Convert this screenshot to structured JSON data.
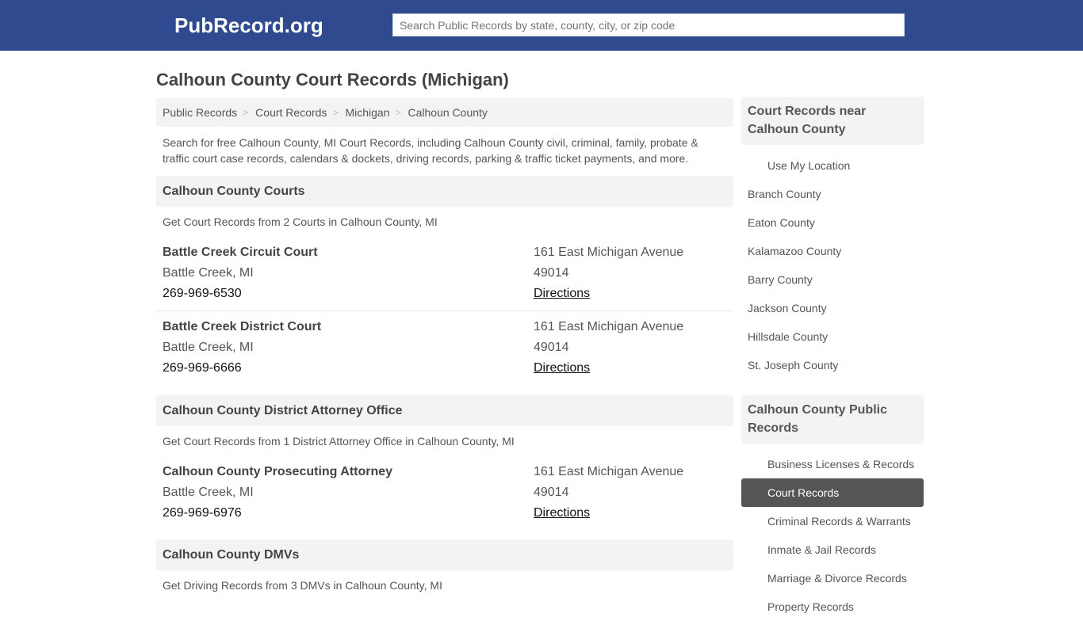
{
  "header": {
    "logo": "PubRecord.org",
    "search_placeholder": "Search Public Records by state, county, city, or zip code",
    "search_value": ""
  },
  "page_title": "Calhoun County Court Records (Michigan)",
  "breadcrumb": [
    {
      "label": "Public Records"
    },
    {
      "label": "Court Records"
    },
    {
      "label": "Michigan"
    },
    {
      "label": "Calhoun County"
    }
  ],
  "breadcrumb_separator": ">",
  "intro": "Search for free Calhoun County, MI Court Records, including Calhoun County civil, criminal, family, probate & traffic court case records, calendars & dockets, driving records, parking & traffic ticket payments, and more.",
  "sections": [
    {
      "title": "Calhoun County Courts",
      "subtitle": "Get Court Records from 2 Courts in Calhoun County, MI",
      "entries": [
        {
          "name": "Battle Creek Circuit Court",
          "city": "Battle Creek, MI",
          "phone": "269-969-6530",
          "address": "161 East Michigan Avenue",
          "zip": "49014",
          "directions": "Directions"
        },
        {
          "name": "Battle Creek District Court",
          "city": "Battle Creek, MI",
          "phone": "269-969-6666",
          "address": "161 East Michigan Avenue",
          "zip": "49014",
          "directions": "Directions"
        }
      ]
    },
    {
      "title": "Calhoun County District Attorney Office",
      "subtitle": "Get Court Records from 1 District Attorney Office in Calhoun County, MI",
      "entries": [
        {
          "name": "Calhoun County Prosecuting Attorney",
          "city": "Battle Creek, MI",
          "phone": "269-969-6976",
          "address": "161 East Michigan Avenue",
          "zip": "49014",
          "directions": "Directions"
        }
      ]
    },
    {
      "title": "Calhoun County DMVs",
      "subtitle": "Get Driving Records from 3 DMVs in Calhoun County, MI",
      "entries": []
    }
  ],
  "sidebar": {
    "nearby": {
      "title": "Court Records near Calhoun County",
      "use_location": "Use My Location",
      "items": [
        "Branch County",
        "Eaton County",
        "Kalamazoo County",
        "Barry County",
        "Jackson County",
        "Hillsdale County",
        "St. Joseph County"
      ]
    },
    "public_records": {
      "title": "Calhoun County Public Records",
      "items": [
        {
          "label": "Business Licenses & Records",
          "active": false
        },
        {
          "label": "Court Records",
          "active": true
        },
        {
          "label": "Criminal Records & Warrants",
          "active": false
        },
        {
          "label": "Inmate & Jail Records",
          "active": false
        },
        {
          "label": "Marriage & Divorce Records",
          "active": false
        },
        {
          "label": "Property Records",
          "active": false
        }
      ]
    }
  },
  "colors": {
    "header_bg": "#2f4a8e",
    "panel_bg": "#f3f3f3",
    "active_bg": "#555555"
  }
}
